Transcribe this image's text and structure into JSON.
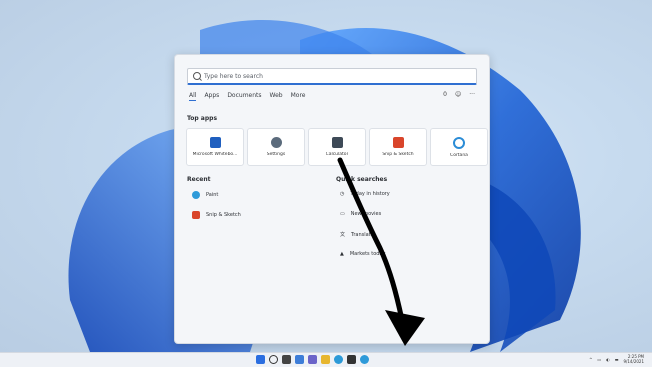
{
  "search": {
    "placeholder": "Type here to search"
  },
  "tabs": [
    "All",
    "Apps",
    "Documents",
    "Web",
    "More"
  ],
  "right_icons": [
    "rewards-icon",
    "account-icon",
    "more-icon"
  ],
  "right_labels": {
    "rewards": "0",
    "more": "···"
  },
  "top_apps": {
    "title": "Top apps",
    "items": [
      {
        "label": "Microsoft Whitebo...",
        "color": "#1f5fbf"
      },
      {
        "label": "Settings",
        "color": "#5b6b7c"
      },
      {
        "label": "Calculator",
        "color": "#3e4a57"
      },
      {
        "label": "Snip & Sketch",
        "color": "#d9452b"
      },
      {
        "label": "Cortana",
        "color": "#2b8cd6"
      }
    ]
  },
  "recent": {
    "title": "Recent",
    "items": [
      {
        "label": "Paint",
        "color": "#2e9ad9"
      },
      {
        "label": "Snip & Sketch",
        "color": "#d9452b"
      }
    ]
  },
  "quick_searches": {
    "title": "Quick searches",
    "items": [
      {
        "label": "Today in history"
      },
      {
        "label": "New movies"
      },
      {
        "label": "Translate"
      },
      {
        "label": "Markets today"
      }
    ]
  },
  "tray": {
    "time": "2:25 PM",
    "date": "9/14/2021"
  },
  "colors": {
    "accent": "#2f6fd1",
    "bloom": "#1f63d6"
  }
}
